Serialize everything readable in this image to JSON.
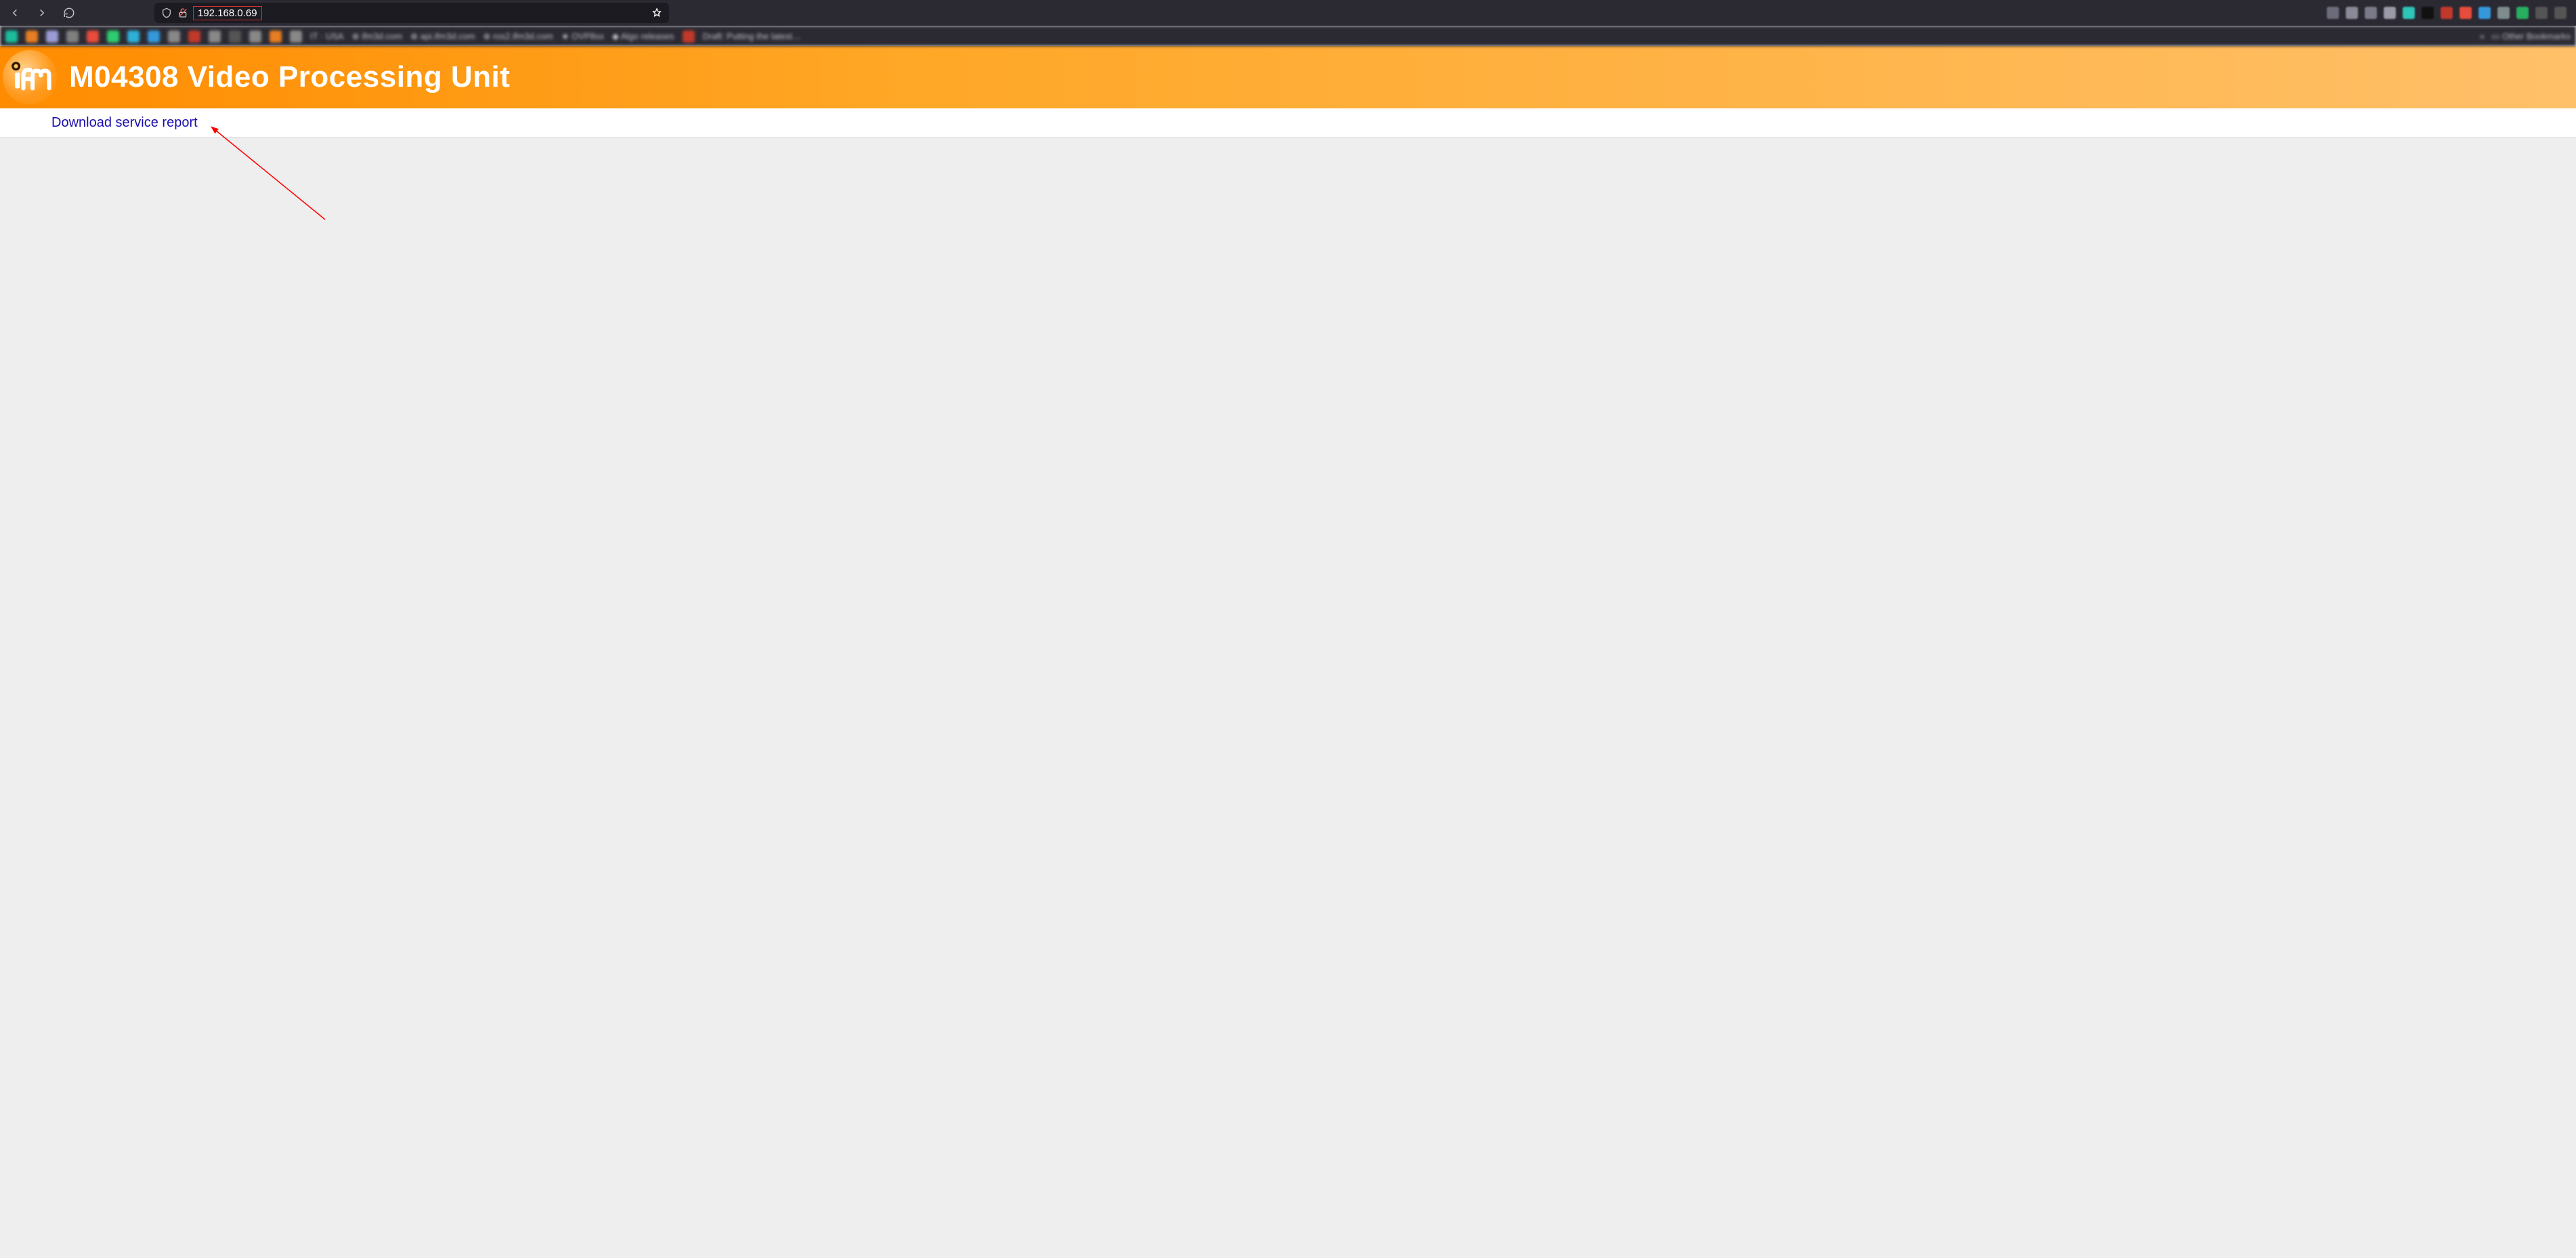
{
  "browser": {
    "url": "192.168.0.69"
  },
  "page": {
    "title": "M04308 Video Processing Unit",
    "download_link_label": "Download service report"
  }
}
